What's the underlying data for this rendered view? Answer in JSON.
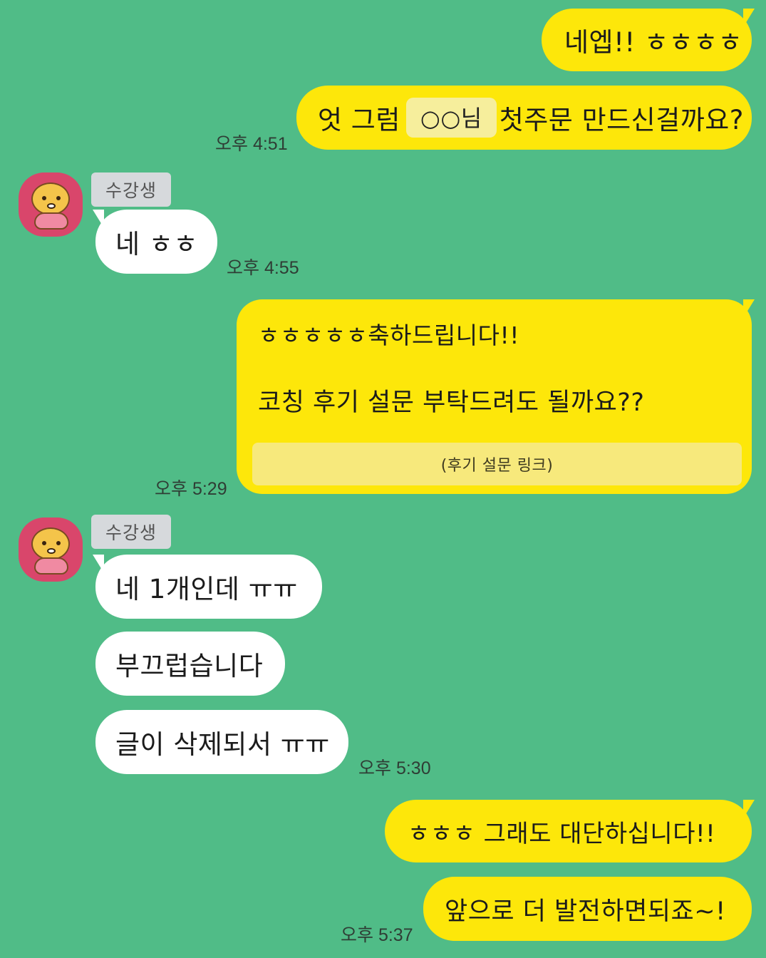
{
  "chat": {
    "messages": {
      "m1": "네엡!! ㅎㅎㅎㅎ",
      "m2_before": "엇 그럼",
      "m2_redacted": "○○님",
      "m2_after": "첫주문 만드신걸까요?",
      "m3": "네 ㅎㅎ",
      "m4_line1": "ㅎㅎㅎㅎㅎ축하드립니다!!",
      "m4_line2": "코칭 후기 설문 부탁드려도 될까요??",
      "m4_link": "(후기 설문 링크)",
      "m5": "네 1개인데 ㅠㅠ",
      "m6": "부끄럽습니다",
      "m7": "글이 삭제되서 ㅠㅠ",
      "m8": "ㅎㅎㅎ 그래도 대단하십니다!!",
      "m9": "앞으로 더 발전하면되죠~!"
    },
    "sender_name": "수강생",
    "times": {
      "t1": "오후 4:51",
      "t2": "오후 4:55",
      "t3": "오후 5:29",
      "t4": "오후 5:30",
      "t5": "오후 5:37"
    },
    "colors": {
      "background": "#50bc87",
      "my_bubble": "#fde70a",
      "their_bubble": "#ffffff"
    },
    "icons": {
      "avatar": "character-avatar-icon"
    }
  }
}
